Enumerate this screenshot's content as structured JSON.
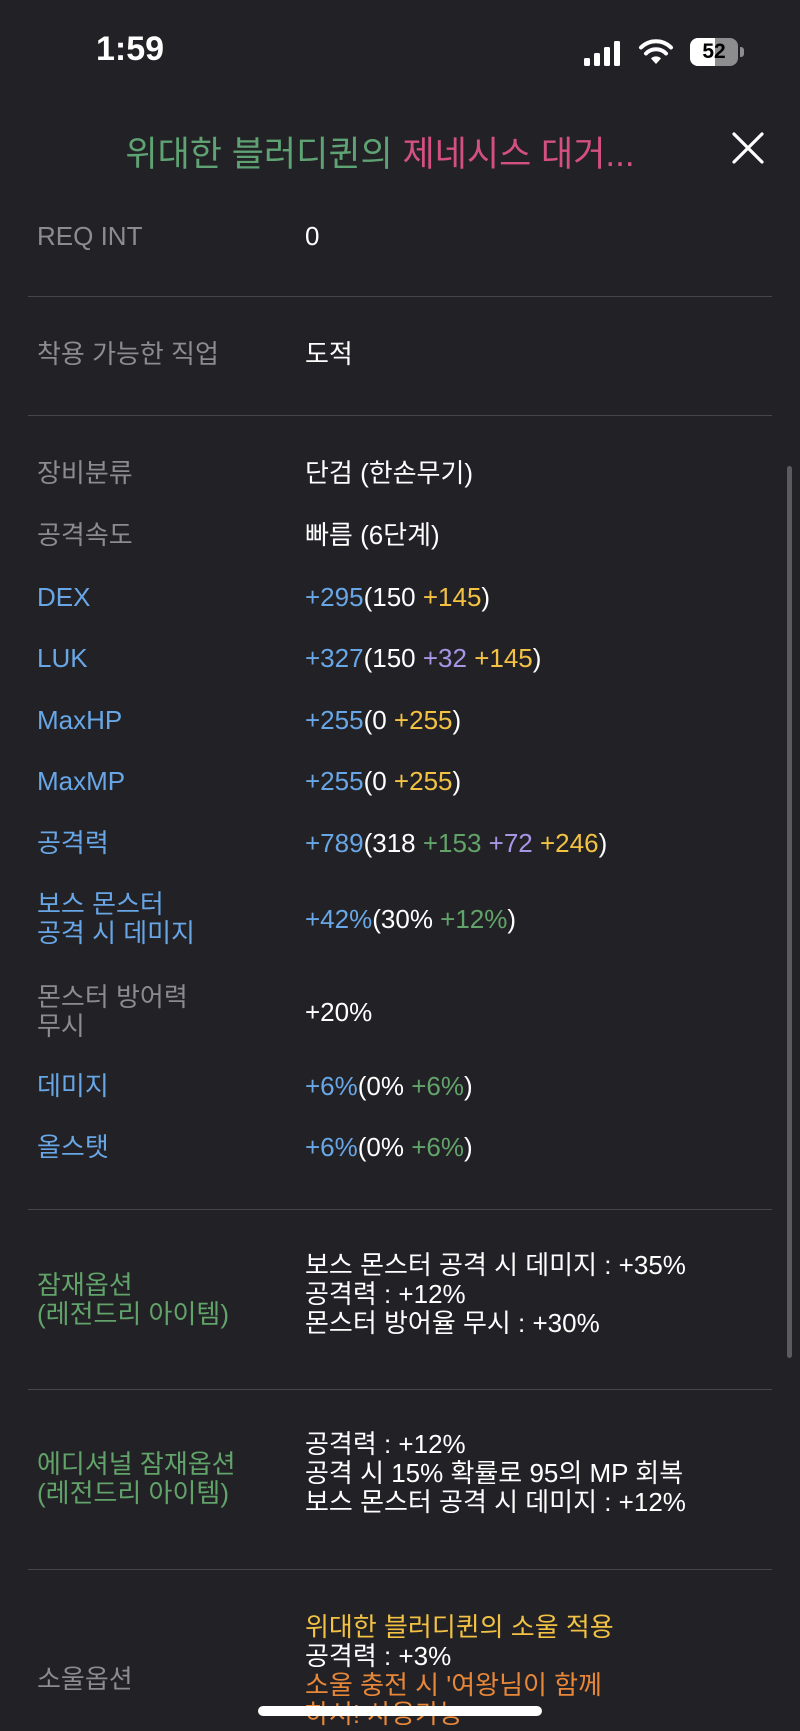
{
  "status_bar": {
    "time": "1:59",
    "battery": "52",
    "battery_percent": 52
  },
  "header": {
    "title_part1": "위대한 블러디퀸의",
    "title_part2": "제네시스 대거...",
    "close_icon": "close-icon"
  },
  "rows": {
    "req_int": {
      "label": "REQ INT",
      "value": "0"
    },
    "job": {
      "label": "착용 가능한 직업",
      "value": "도적"
    },
    "category": {
      "label": "장비분류",
      "value": "단검 (한손무기)"
    },
    "speed": {
      "label": "공격속도",
      "value": "빠름 (6단계)"
    },
    "dex": {
      "label": "DEX",
      "total": "+295",
      "open": "(150 ",
      "star": "+145",
      "close": ")"
    },
    "luk": {
      "label": "LUK",
      "total": "+327",
      "open": "(150 ",
      "add": "+32",
      "sep": " ",
      "star": "+145",
      "close": ")"
    },
    "maxhp": {
      "label": "MaxHP",
      "total": "+255",
      "open": "(0 ",
      "star": "+255",
      "close": ")"
    },
    "maxmp": {
      "label": "MaxMP",
      "total": "+255",
      "open": "(0 ",
      "star": "+255",
      "close": ")"
    },
    "atk": {
      "label": "공격력",
      "total": "+789",
      "open": "(318 ",
      "flame": "+153",
      "sep1": " ",
      "add": "+72",
      "sep2": " ",
      "star": "+246",
      "close": ")"
    },
    "boss": {
      "label_l1": "보스 몬스터",
      "label_l2": "공격 시 데미지",
      "total": "+42%",
      "open": "(30% ",
      "flame": "+12%",
      "close": ")"
    },
    "ignore": {
      "label_l1": "몬스터 방어력",
      "label_l2": "무시",
      "value": "+20%"
    },
    "damage": {
      "label": "데미지",
      "total": "+6%",
      "open": "(0% ",
      "flame": "+6%",
      "close": ")"
    },
    "allstat": {
      "label": "올스탯",
      "total": "+6%",
      "open": "(0% ",
      "flame": "+6%",
      "close": ")"
    }
  },
  "potential": {
    "label_l1": "잠재옵션",
    "label_l2": "(레전드리 아이템)",
    "lines": [
      "보스 몬스터 공격 시 데미지 : +35%",
      "공격력 : +12%",
      "몬스터 방어율 무시 : +30%"
    ]
  },
  "additional": {
    "label_l1": "에디셔널 잠재옵션",
    "label_l2": "(레전드리 아이템)",
    "lines": [
      "공격력 : +12%",
      "공격 시 15% 확률로 95의 MP 회복",
      "보스 몬스터 공격 시 데미지 : +12%"
    ]
  },
  "soul": {
    "label": "소울옵션",
    "line1": "위대한 블러디퀸의 소울 적용",
    "line2": "공격력 : +3%",
    "line3": "소울 충전 시 '여왕님이 함께",
    "line4": "하셔! 사용가능"
  },
  "colors": {
    "background": "#222226",
    "label_gray": "#8c8c90",
    "stat_blue": "#68a6e6",
    "star_yellow": "#f3c243",
    "add_purple": "#a895e6",
    "flame_green": "#62a36a",
    "title_green": "#5fa273",
    "title_pink": "#d4507f",
    "soul_orange": "#e98739"
  }
}
